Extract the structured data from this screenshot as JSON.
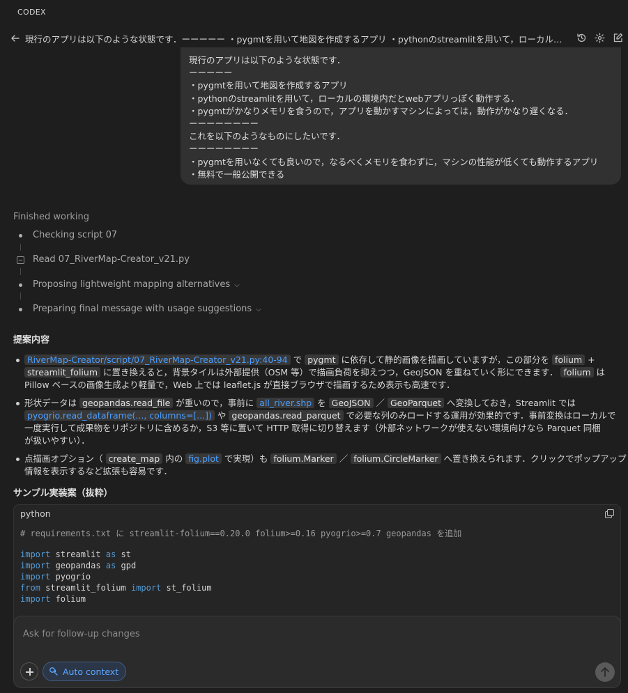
{
  "app": {
    "brand": "CODEX"
  },
  "header": {
    "title": "現行のアプリは以下のような状態です．ーーーーー ・pygmtを用いて地図を作成するアプリ ・pythonのstreamlitを用いて，ローカルの環境内だとwebアプリっぽく動作する．・pygmtがかなりメモリを食うので"
  },
  "user_message": {
    "lines": [
      "現行のアプリは以下のような状態です．",
      "ーーーーー",
      "・pygmtを用いて地図を作成するアプリ",
      "・pythonのstreamlitを用いて，ローカルの環境内だとwebアプリっぽく動作する．",
      "・pygmtがかなりメモリを食うので，アプリを動かすマシンによっては，動作がかなり遅くなる．",
      "ーーーーーーーー",
      "これを以下のようなものにしたいです．",
      "ーーーーーーーー",
      "・pygmtを用いなくても良いので，なるべくメモリを食わずに，マシンの性能が低くても動作するアプリ",
      "・無料で一般公開できる"
    ]
  },
  "working": {
    "status": "Finished working",
    "steps": [
      {
        "label": "Checking script 07"
      },
      {
        "label": "Read 07_RiverMap-Creator_v21.py"
      },
      {
        "label": "Proposing lightweight mapping alternatives",
        "chevron": "⌵"
      },
      {
        "label": "Preparing final message with usage suggestions",
        "chevron": "⌵"
      }
    ]
  },
  "response": {
    "heading_proposal": "提案内容",
    "b1": {
      "l1_link": "RiverMap-Creator/script/07_RiverMap-Creator_v21.py:40-94",
      "l1_t1": "で",
      "l1_c1": "pygmt",
      "l1_t2": "に依存して静的画像を描画していますが，この部分を",
      "l1_c2": "folium",
      "l1_t3": "+",
      "l2_c1": "streamlit_folium",
      "l2_t1": "に置き換えると，背景タイルは外部提供（OSM 等）で描画負荷を抑えつつ，GeoJSON を重ねていく形にできます．",
      "l2_c2": "folium",
      "l2_t2": "は",
      "l3": "Pillow ベースの画像生成より軽量で，Web 上では leaflet.js が直接ブラウザで描画するため表示も高速です．"
    },
    "b2": {
      "l1_t1": "形状データは",
      "l1_c1": "geopandas.read_file",
      "l1_t2": "が重いので，事前に",
      "l1_link": "all_river.shp",
      "l1_t3": "を",
      "l1_c2": "GeoJSON",
      "l1_t4": "／",
      "l1_c3": "GeoParquet",
      "l1_t5": "へ変換しておき，Streamlit では",
      "l2_link": "pyogrio.read_dataframe(..., columns=[...])",
      "l2_t1": "や",
      "l2_c1": "geopandas.read_parquet",
      "l2_t2": "で必要な列のみロードする運用が効果的です．事前変換はローカルで",
      "l3": "一度実行して成果物をリポジトリに含めるか，S3 等に置いて HTTP 取得に切り替えます（外部ネットワークが使えない環境向けなら Parquet 同梱",
      "l4": "が扱いやすい）．"
    },
    "b3": {
      "l1_t1": "点描画オプション（",
      "l1_c1": "create_map",
      "l1_t2": "内の",
      "l1_link": "fig.plot",
      "l1_t3": "で実現）も",
      "l1_c2": "folium.Marker",
      "l1_t4": "／",
      "l1_c3": "folium.CircleMarker",
      "l1_t5": "へ置き換えられます．クリックでポップアップ",
      "l2": "情報を表示するなど拡張も容易です．"
    },
    "heading_sample": "サンプル実装案（抜粋）"
  },
  "code_block": {
    "language": "python",
    "comment": "# requirements.txt に streamlit-folium==0.20.0 folium>=0.16 pyogrio>=0.7 geopandas を追加",
    "lines": [
      {
        "kw1": "import",
        "rest1": " streamlit ",
        "kw2": "as",
        "rest2": " st"
      },
      {
        "kw1": "import",
        "rest1": " geopandas ",
        "kw2": "as",
        "rest2": " gpd"
      },
      {
        "kw1": "import",
        "rest1": " pyogrio",
        "kw2": "",
        "rest2": ""
      },
      {
        "kw1": "from",
        "rest1": " streamlit_folium ",
        "kw2": "import",
        "rest2": " st_folium"
      },
      {
        "kw1": "import",
        "rest1": " folium",
        "kw2": "",
        "rest2": ""
      }
    ]
  },
  "composer": {
    "placeholder": "Ask for follow-up changes",
    "context_button": "Auto context"
  }
}
